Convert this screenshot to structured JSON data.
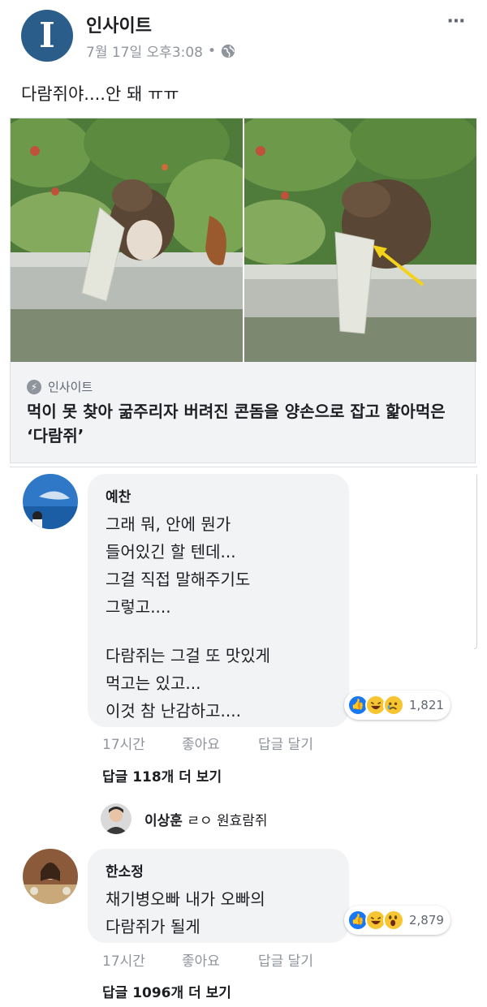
{
  "post": {
    "page_name": "인사이트",
    "logo_letter": "I",
    "timestamp": "7월 17일 오후3:08",
    "privacy_separator": "•",
    "more_icon": "⋯",
    "text": "다람쥐야....안 돼 ㅠㅠ"
  },
  "link_card": {
    "source": "인사이트",
    "title": "먹이 못 찾아 굶주리자 버려진 콘돔을 양손으로 잡고 핥아먹은 ‘다람쥐’"
  },
  "comments": [
    {
      "author": "예찬",
      "lines": [
        "그래 뭐, 안에 뭔가",
        "들어있긴 할 텐데...",
        "그걸 직접 말해주기도",
        "그렇고....",
        "",
        "다람쥐는 그걸 또 맛있게",
        "먹고는 있고...",
        "이것 참 난감하고...."
      ],
      "reaction_count": "1,821",
      "reaction_icons": [
        "like-icon",
        "haha-icon",
        "sad-icon"
      ],
      "time": "17시간",
      "like_label": "좋아요",
      "reply_label": "답글 달기",
      "more_replies": "답글 118개 더 보기",
      "reply_preview": {
        "author": "이상훈",
        "text": "ㄹㅇ 원효람쥐"
      }
    },
    {
      "author": "한소정",
      "lines": [
        "채기병오빠 내가 오빠의",
        "다람쥐가 될게"
      ],
      "reaction_count": "2,879",
      "reaction_icons": [
        "like-icon",
        "haha-icon",
        "wow-icon"
      ],
      "time": "17시간",
      "like_label": "좋아요",
      "reply_label": "답글 달기",
      "more_replies": "답글 1096개 더 보기"
    }
  ],
  "colors": {
    "logo": "#2a5d8a",
    "bubble": "#f2f3f5",
    "like": "#1877f2",
    "emoji": "#f7c531",
    "arrow": "#f5d21a"
  }
}
